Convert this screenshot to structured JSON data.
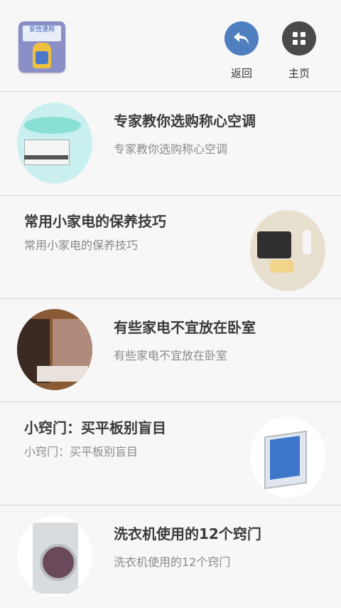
{
  "header": {
    "logo_text": "安信速邦",
    "back_label": "返回",
    "home_label": "主页"
  },
  "articles": [
    {
      "title": "专家教你选购称心空调",
      "subtitle": "专家教你选购称心空调",
      "thumb_icon": "air-conditioner-photo"
    },
    {
      "title": "常用小家电的保养技巧",
      "subtitle": "常用小家电的保养技巧",
      "thumb_icon": "kitchen-appliance-photo"
    },
    {
      "title": "有些家电不宜放在卧室",
      "subtitle": "有些家电不宜放在卧室",
      "thumb_icon": "bedroom-photo"
    },
    {
      "title": "小窍门：买平板别盲目",
      "subtitle": "小窍门：买平板别盲目",
      "thumb_icon": "tablet-photo"
    },
    {
      "title": "洗衣机使用的12个窍门",
      "subtitle": "洗衣机使用的12个窍门",
      "thumb_icon": "washing-machine-photo"
    }
  ],
  "colors": {
    "back_button": "#4f7fbf",
    "home_button": "#4a4a4a",
    "title_text": "#3a3a3a",
    "subtitle_text": "#8a8a8a"
  }
}
